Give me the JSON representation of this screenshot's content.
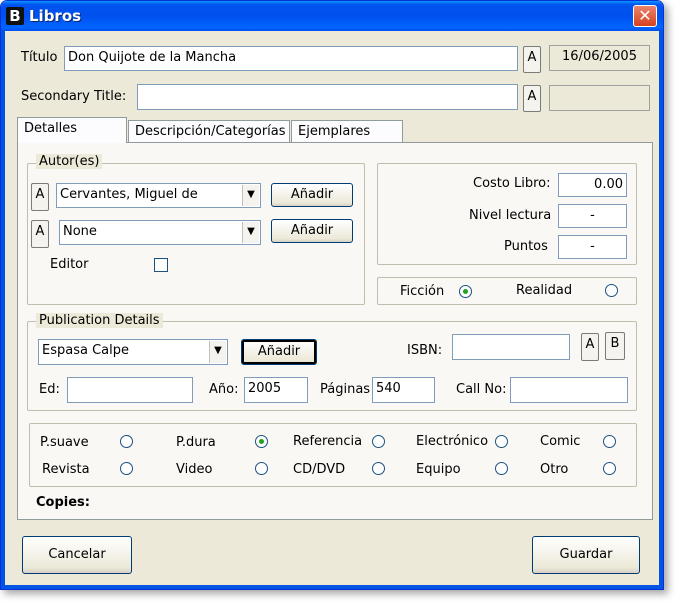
{
  "window": {
    "title": "Libros",
    "app_icon": "B"
  },
  "header": {
    "title_label": "Título",
    "title_value": "Don Quijote de la Mancha",
    "title_a_button": "A",
    "date": "16/06/2005",
    "secondary_title_label": "Secondary Title:",
    "secondary_title_value": "",
    "secondary_a_button": "A",
    "secondary_extra": ""
  },
  "tabs": [
    {
      "label": "Detalles",
      "active": true
    },
    {
      "label": "Descripción/Categorías",
      "active": false
    },
    {
      "label": "Ejemplares",
      "active": false
    }
  ],
  "authors": {
    "legend": "Autor(es)",
    "rows": [
      {
        "a_button": "A",
        "value": "Cervantes, Miguel de",
        "add_button": "Añadir"
      },
      {
        "a_button": "A",
        "value": "None",
        "add_button": "Añadir"
      }
    ],
    "editor_label": "Editor",
    "editor_checked": false
  },
  "costs": {
    "costo_label": "Costo Libro:",
    "costo_value": "0.00",
    "nivel_label": "Nivel lectura",
    "nivel_value": "-",
    "puntos_label": "Puntos",
    "puntos_value": "-"
  },
  "fiction": {
    "ficcion_label": "Ficción",
    "ficcion_checked": true,
    "realidad_label": "Realidad",
    "realidad_checked": false
  },
  "publication": {
    "legend": "Publication Details",
    "publisher": "Espasa Calpe",
    "add_button": "Añadir",
    "isbn_label": "ISBN:",
    "isbn_value": "",
    "isbn_a_button": "A",
    "isbn_b_button": "B",
    "ed_label": "Ed:",
    "ed_value": "",
    "year_label": "Año:",
    "year_value": "2005",
    "pages_label": "Páginas",
    "pages_value": "540",
    "callno_label": "Call No:",
    "callno_value": ""
  },
  "format": {
    "options": [
      {
        "label": "P.suave",
        "checked": false
      },
      {
        "label": "P.dura",
        "checked": true
      },
      {
        "label": "Referencia",
        "checked": false
      },
      {
        "label": "Electrónico",
        "checked": false
      },
      {
        "label": "Comic",
        "checked": false
      },
      {
        "label": "Revista",
        "checked": false
      },
      {
        "label": "Video",
        "checked": false
      },
      {
        "label": "CD/DVD",
        "checked": false
      },
      {
        "label": "Equipo",
        "checked": false
      },
      {
        "label": "Otro",
        "checked": false
      }
    ]
  },
  "copies_label": "Copies:",
  "footer": {
    "cancel": "Cancelar",
    "save": "Guardar"
  }
}
